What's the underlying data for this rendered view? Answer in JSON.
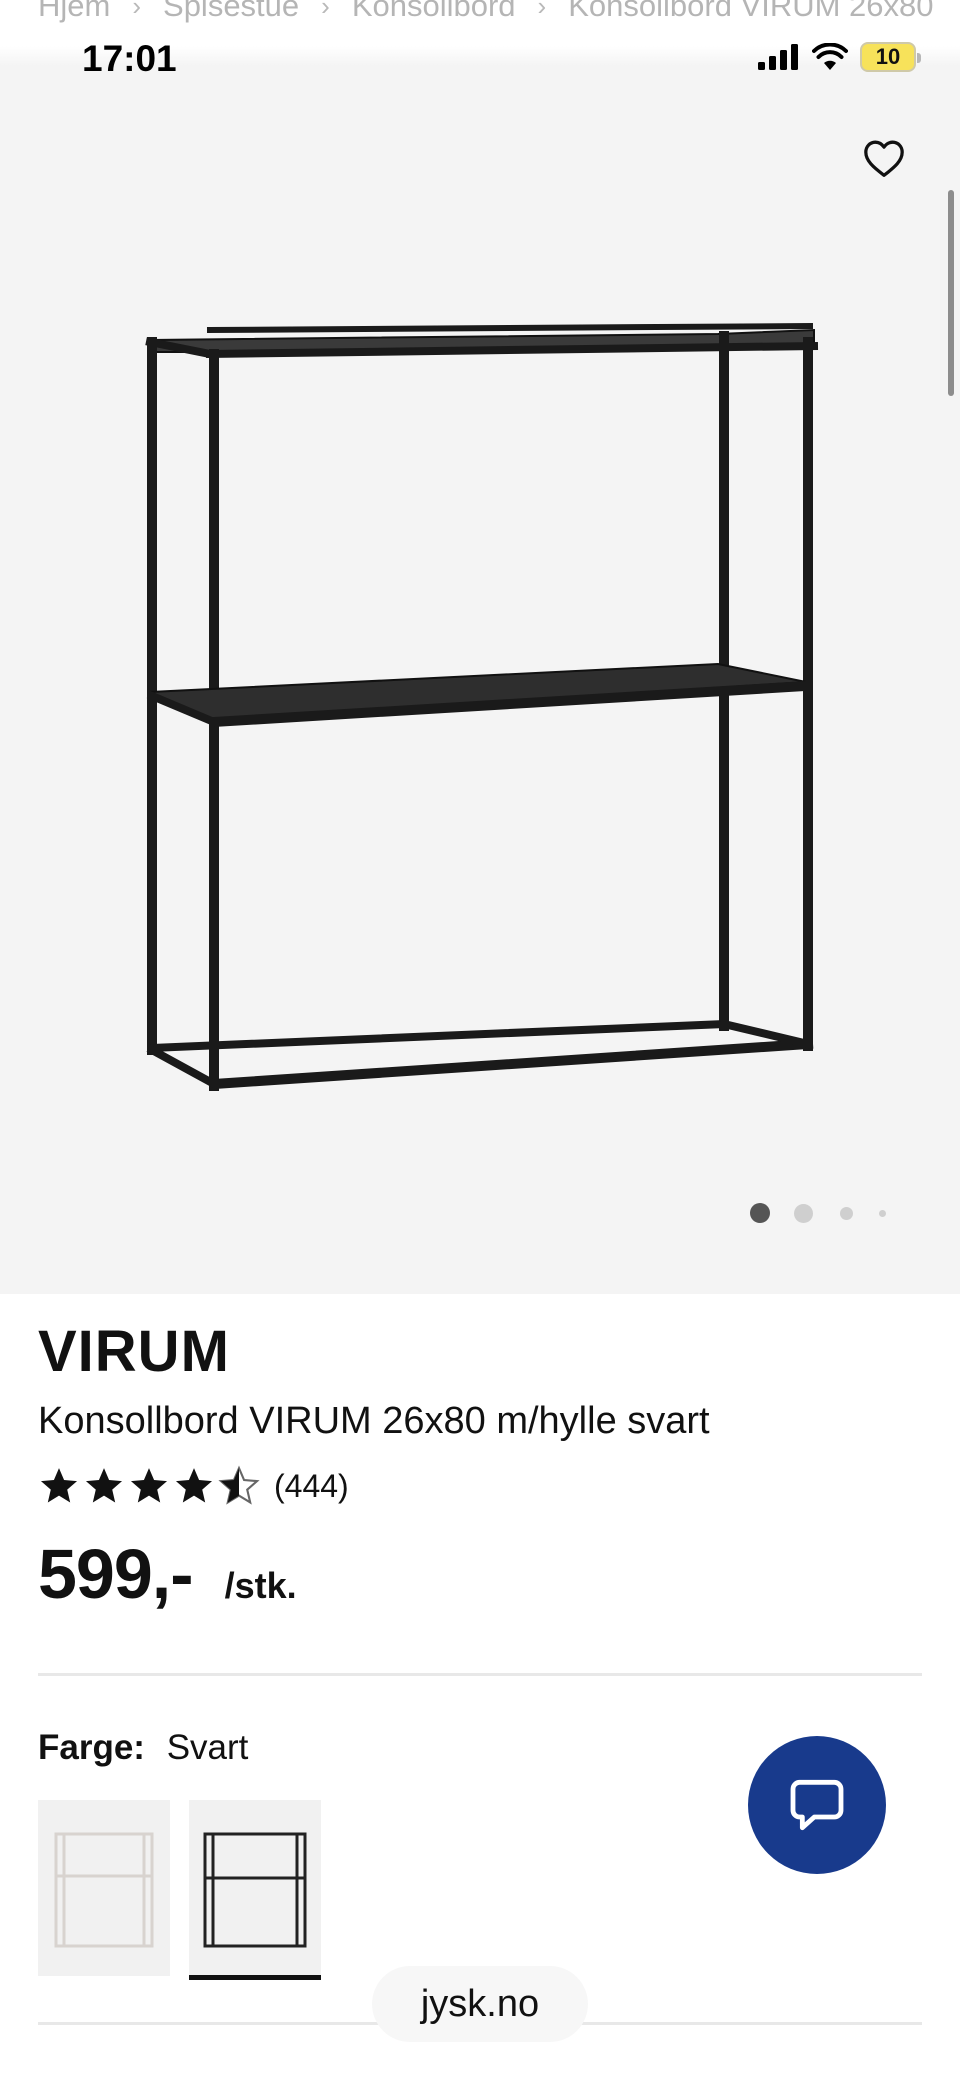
{
  "breadcrumb": {
    "items": [
      "Hjem",
      "Spisestue",
      "Konsollbord",
      "Konsollbord VIRUM 26x80"
    ],
    "separator": "›"
  },
  "status_bar": {
    "time": "17:01",
    "battery": "10",
    "icons": [
      "cellular-signal-icon",
      "wifi-icon",
      "battery-icon"
    ]
  },
  "gallery": {
    "image_count": 4,
    "active_index": 0,
    "favorite_icon": "heart-outline-icon"
  },
  "product": {
    "brand": "VIRUM",
    "name": "Konsollbord VIRUM 26x80 m/hylle svart",
    "rating": 4.5,
    "rating_max": 5,
    "rating_count": "(444)",
    "price": "599,-",
    "unit": "/stk."
  },
  "color_selector": {
    "label": "Farge:",
    "value": "Svart",
    "options": [
      {
        "name": "Hvit",
        "selected": false
      },
      {
        "name": "Svart",
        "selected": true
      }
    ]
  },
  "chat": {
    "icon": "chat-bubble-icon"
  },
  "browser": {
    "url": "jysk.no"
  },
  "colors": {
    "gallery_bg": "#f4f4f4",
    "chat_button": "#183a8c",
    "battery": "#f7e25a",
    "text": "#111111"
  }
}
